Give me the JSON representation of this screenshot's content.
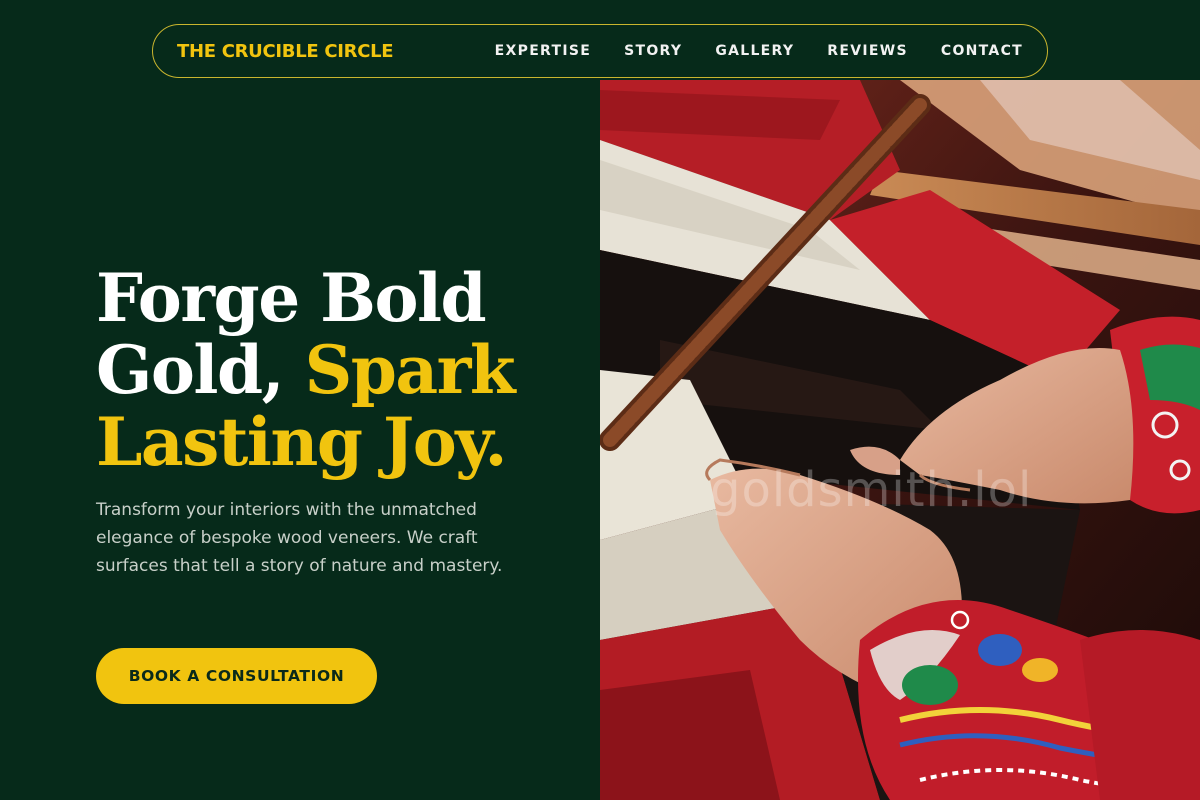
{
  "brand": {
    "name": "THE CRUCIBLE CIRCLE"
  },
  "nav": {
    "items": [
      {
        "label": "EXPERTISE"
      },
      {
        "label": "STORY"
      },
      {
        "label": "GALLERY"
      },
      {
        "label": "REVIEWS"
      },
      {
        "label": "CONTACT"
      }
    ]
  },
  "hero": {
    "title_line1": "Forge Bold",
    "title_line2_white": "Gold, ",
    "title_line2_gold": "Spark",
    "title_line3_gold": "Lasting Joy.",
    "description": "Transform your interiors with the unmatched elegance of bespoke wood veneers. We craft surfaces that tell a story of nature and mastery.",
    "cta_label": "BOOK A CONSULTATION",
    "image_watermark": "goldsmith.lol"
  },
  "colors": {
    "background": "#062a1a",
    "accent_gold": "#f1c40f",
    "text_white": "#ffffff",
    "text_muted": "#c8d0c9"
  }
}
